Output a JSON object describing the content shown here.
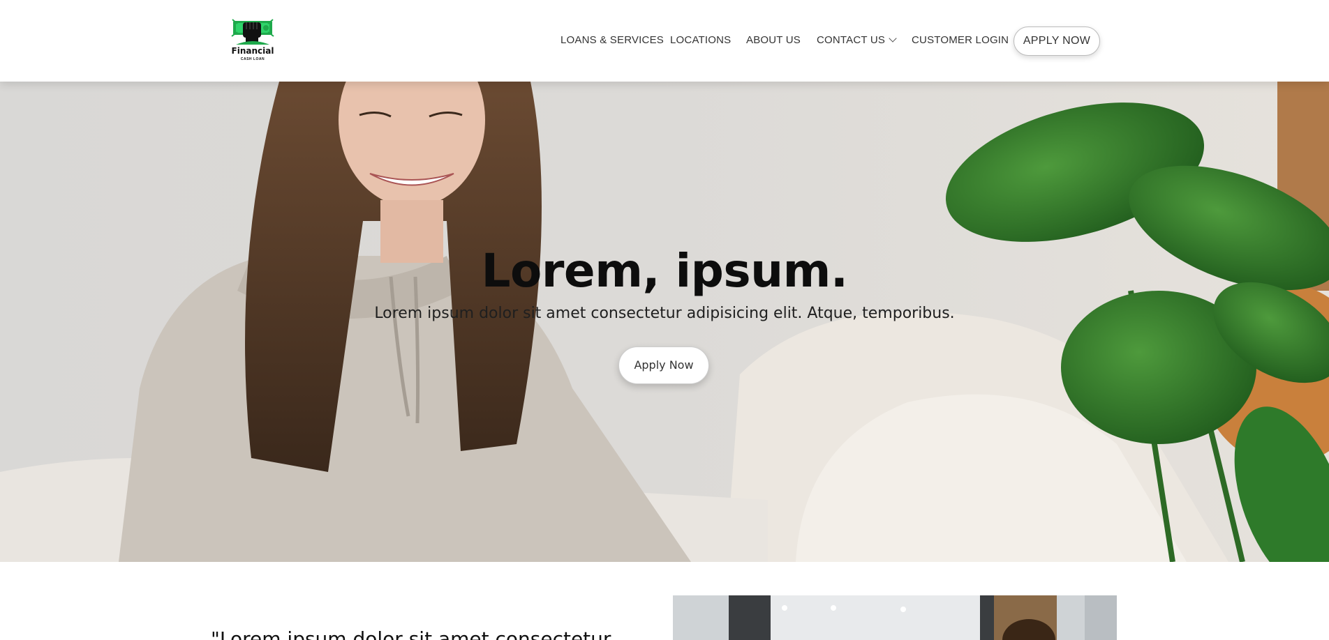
{
  "brand": {
    "name": "Financial",
    "tagline": "CASH LOAN",
    "logo_icon": "fist-money-icon",
    "accent_color": "#1ea94b"
  },
  "nav": {
    "items": [
      {
        "label": "LOANS & SERVICES"
      },
      {
        "label": "LOCATIONS"
      },
      {
        "label": "ABOUT US"
      },
      {
        "label": "CONTACT US",
        "has_dropdown": true,
        "icon": "chevron-down-icon"
      },
      {
        "label": "CUSTOMER LOGIN"
      }
    ],
    "cta_label": "APPLY NOW"
  },
  "hero": {
    "title": "Lorem, ipsum.",
    "subtitle": "Lorem ipsum dolor sit amet consectetur adipisicing elit. Atque, temporibus.",
    "button_label": "Apply Now"
  },
  "intro": {
    "quote": "\"Lorem ipsum dolor sit amet consectetur"
  }
}
